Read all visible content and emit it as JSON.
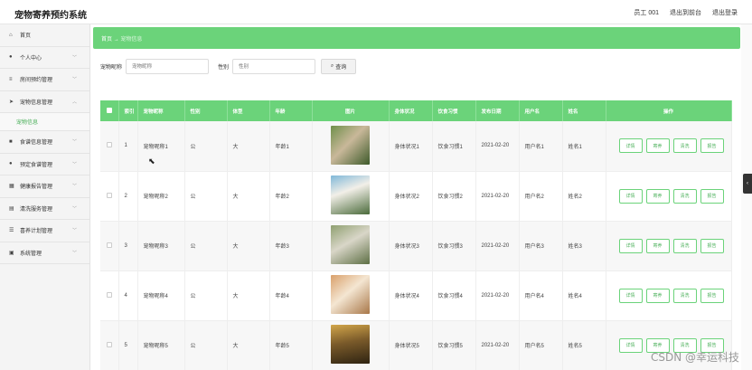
{
  "app": {
    "title": "宠物寄养预约系统"
  },
  "header": {
    "user": "员工 001",
    "back_label": "退出到前台",
    "logout_label": "退出登录"
  },
  "sidebar": {
    "items": [
      {
        "label": "首页",
        "icon": "home-icon",
        "glyph": "⌂"
      },
      {
        "label": "个人中心",
        "icon": "user-icon",
        "glyph": "●"
      },
      {
        "label": "房间预约管理",
        "icon": "list-icon",
        "glyph": "≡"
      },
      {
        "label": "宠物信息管理",
        "icon": "send-icon",
        "glyph": "➤"
      },
      {
        "label": "宠物信息",
        "icon": "",
        "glyph": ""
      },
      {
        "label": "食谱信息管理",
        "icon": "book-icon",
        "glyph": "■"
      },
      {
        "label": "预定食谱管理",
        "icon": "user-icon",
        "glyph": "●"
      },
      {
        "label": "健康报告管理",
        "icon": "bar-icon",
        "glyph": "▦"
      },
      {
        "label": "清洗服务管理",
        "icon": "bank-icon",
        "glyph": "▤"
      },
      {
        "label": "喜养计划管理",
        "icon": "sliders-icon",
        "glyph": "☰"
      },
      {
        "label": "系统管理",
        "icon": "grid-icon",
        "glyph": "▣"
      }
    ]
  },
  "breadcrumb": {
    "home": "首页",
    "sep": "→",
    "current": "宠物信息"
  },
  "search": {
    "name_label": "宠物昵称",
    "name_placeholder": "宠物昵称",
    "gender_label": "性别",
    "gender_placeholder": "性别",
    "button_label": "查询"
  },
  "table": {
    "headers": [
      "",
      "索引",
      "宠物昵称",
      "性别",
      "体型",
      "年龄",
      "图片",
      "身体状况",
      "饮食习惯",
      "发布日期",
      "用户名",
      "姓名",
      "操作"
    ],
    "actions": [
      "详情",
      "寄养",
      "清洗",
      "报告"
    ],
    "rows": [
      {
        "index": "1",
        "name": "宠物昵称1",
        "gender": "公",
        "size": "大",
        "age": "年龄1",
        "health": "身体状况1",
        "diet": "饮食习惯1",
        "date": "2021-02-20",
        "username": "用户名1",
        "realname": "姓名1"
      },
      {
        "index": "2",
        "name": "宠物昵称2",
        "gender": "公",
        "size": "大",
        "age": "年龄2",
        "health": "身体状况2",
        "diet": "饮食习惯2",
        "date": "2021-02-20",
        "username": "用户名2",
        "realname": "姓名2"
      },
      {
        "index": "3",
        "name": "宠物昵称3",
        "gender": "公",
        "size": "大",
        "age": "年龄3",
        "health": "身体状况3",
        "diet": "饮食习惯3",
        "date": "2021-02-20",
        "username": "用户名3",
        "realname": "姓名3"
      },
      {
        "index": "4",
        "name": "宠物昵称4",
        "gender": "公",
        "size": "大",
        "age": "年龄4",
        "health": "身体状况4",
        "diet": "饮食习惯4",
        "date": "2021-02-20",
        "username": "用户名4",
        "realname": "姓名4"
      },
      {
        "index": "5",
        "name": "宠物昵称5",
        "gender": "公",
        "size": "大",
        "age": "年龄5",
        "health": "身体状况5",
        "diet": "饮食习惯5",
        "date": "2021-02-20",
        "username": "用户名5",
        "realname": "姓名5"
      }
    ]
  },
  "watermark": "CSDN @幸运科技",
  "colors": {
    "accent": "#6bd37a",
    "accent_dark": "#4cb05b"
  }
}
